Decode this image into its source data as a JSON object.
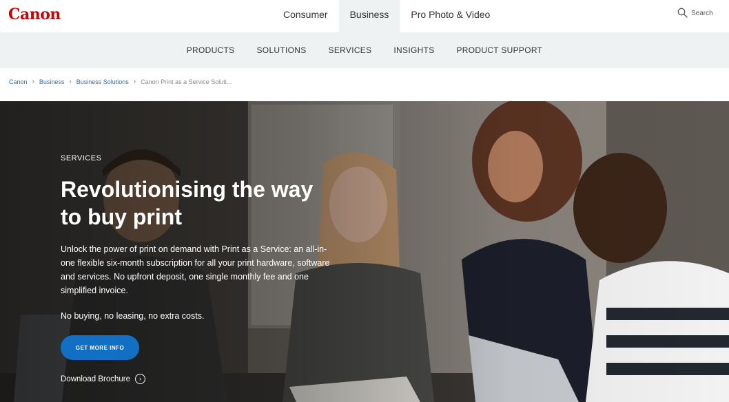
{
  "header": {
    "logo": "Canon",
    "nav": [
      {
        "label": "Consumer",
        "active": false
      },
      {
        "label": "Business",
        "active": true
      },
      {
        "label": "Pro Photo & Video",
        "active": false
      }
    ],
    "search_label": "Search"
  },
  "sub_nav": {
    "items": [
      "PRODUCTS",
      "SOLUTIONS",
      "SERVICES",
      "INSIGHTS",
      "PRODUCT SUPPORT"
    ]
  },
  "breadcrumb": {
    "items": [
      "Canon",
      "Business",
      "Business Solutions"
    ],
    "separator": "›",
    "current": "Canon Print as a Service Soluti..."
  },
  "hero": {
    "eyebrow": "SERVICES",
    "headline": "Revolutionising the way to buy print",
    "body": "Unlock the power of print on demand with Print as a Service: an all-in-one flexible six-month subscription for all your print hardware, software and services. No upfront deposit, one single monthly fee and one simplified invoice.",
    "tagline": "No buying, no leasing, no extra costs.",
    "cta_label": "GET MORE INFO",
    "download_label": "Download Brochure"
  },
  "colors": {
    "brand": "#cc0000",
    "link": "#2a6fb3",
    "cta": "#1170c4",
    "nav_bg": "#eef2f2"
  },
  "icons": {
    "search": "search-icon",
    "download": "chevron-right-circle-icon"
  }
}
